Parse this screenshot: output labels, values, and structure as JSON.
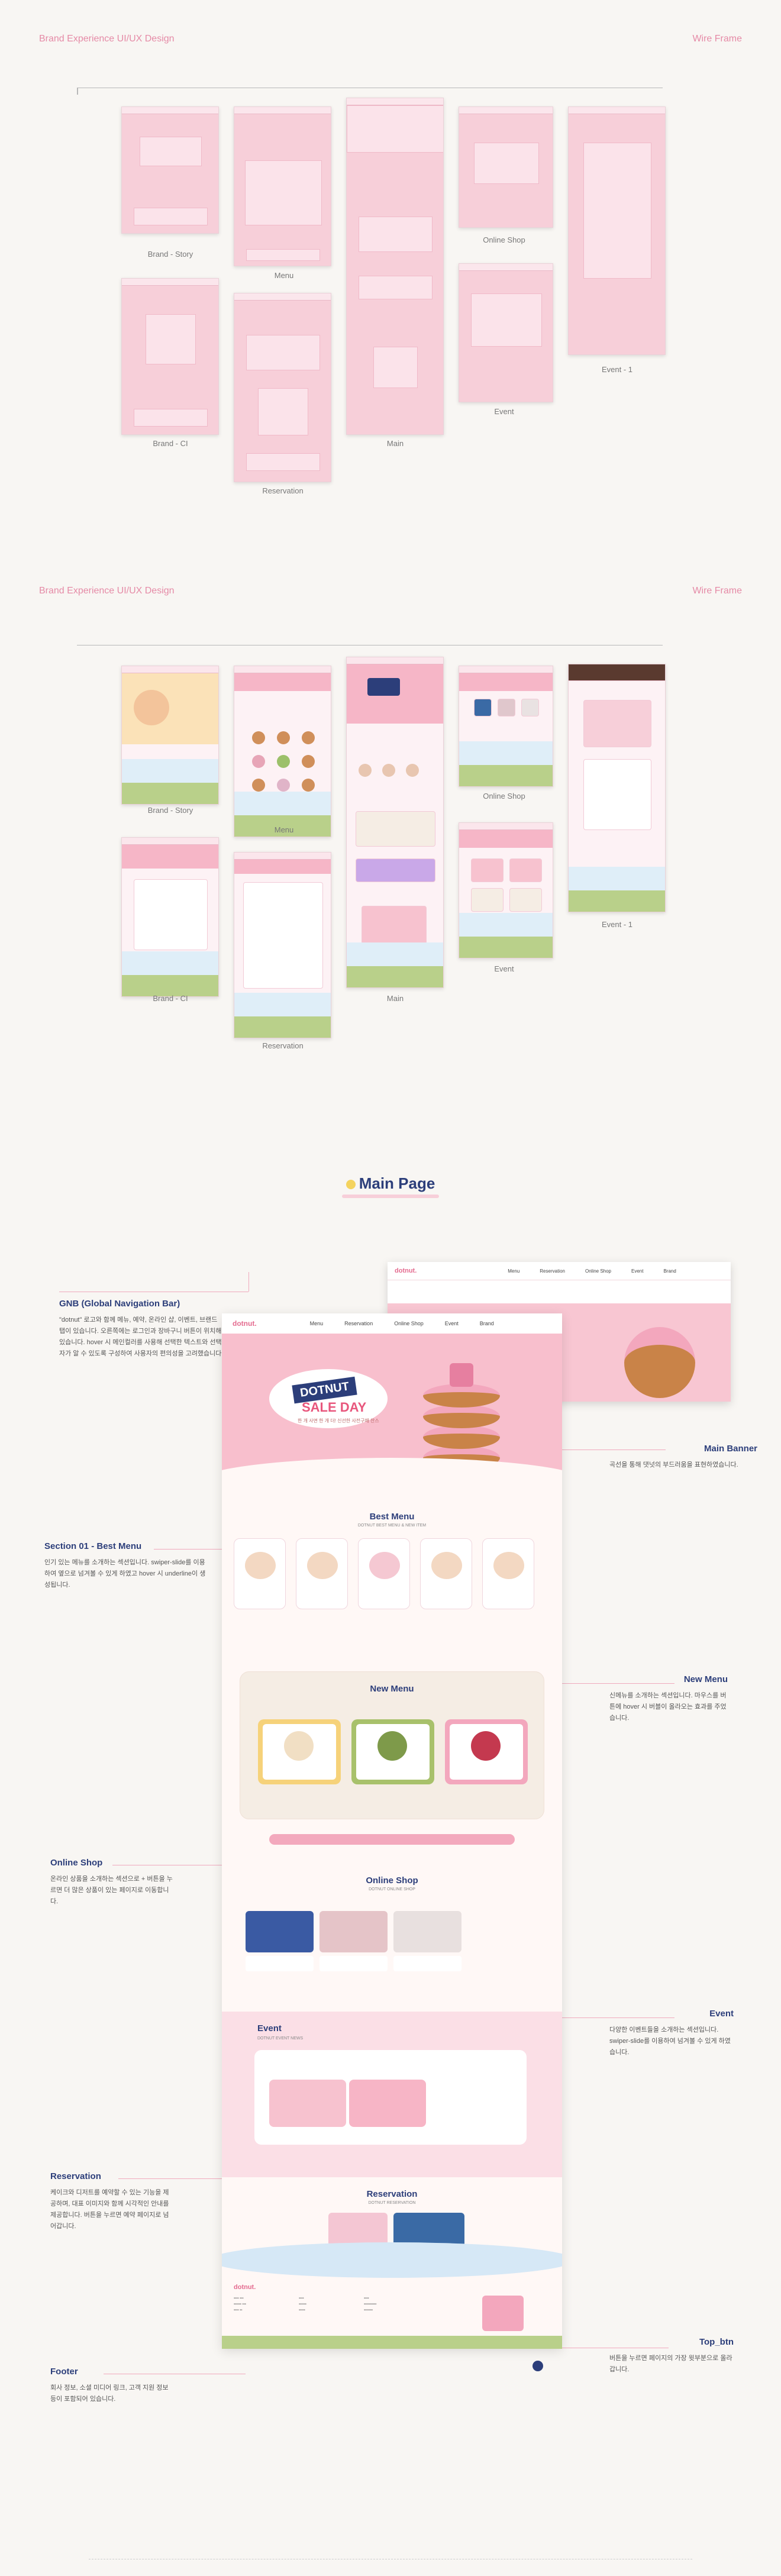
{
  "headers": [
    {
      "left": "Brand Experience UI/UX Design",
      "right": "Wire Frame"
    },
    {
      "left": "Brand Experience UI/UX Design",
      "right": "Wire Frame"
    }
  ],
  "frame_labels": {
    "brand_story": "Brand - Story",
    "brand_ci": "Brand - CI",
    "menu": "Menu",
    "reservation": "Reservation",
    "main": "Main",
    "online_shop": "Online Shop",
    "event": "Event",
    "event_1": "Event - 1"
  },
  "main_page": {
    "title": "Main Page"
  },
  "annotations": {
    "gnb": {
      "title": "GNB (Global Navigation Bar)",
      "body": "\"dotnut\" 로고와 함께 메뉴, 예약, 온라인 샵, 이벤트, 브랜드 탭이 있습니다. 오른쪽에는 로그인과 장바구니 버튼이 위치해 있습니다. hover 시 메인컬러를 사용해 선택한 텍스트와 선택자가 알 수 있도록 구성하여 사용자의 편의성을 고려했습니다."
    },
    "main_banner": {
      "title": "Main Banner",
      "body": "곡선을 통해 댓넛의 부드러움을 표현하였습니다."
    },
    "best_menu": {
      "title": "Section 01 - Best Menu",
      "body": "인기 있는 메뉴를 소개하는 섹션입니다. swiper-slide를 이용하여 옆으로 넘겨볼 수 있게 하였고 hover 시 underline이 생성됩니다."
    },
    "new_menu": {
      "title": "New Menu",
      "body": "신메뉴를 소개하는 섹션입니다. 마우스를 버튼에 hover 시 버블이 올라오는 효과를 주었습니다."
    },
    "online_shop": {
      "title": "Online Shop",
      "body": "온라인 상품을 소개하는 섹션으로 + 버튼을 누르면 더 많은 상품이 있는 페이지로 이동합니다."
    },
    "event": {
      "title": "Event",
      "body": "다양한 이벤트들을 소개하는 섹션입니다. swiper-slide를 이용하여 넘겨볼 수 있게 하였습니다."
    },
    "reservation": {
      "title": "Reservation",
      "body": "케이크와 디저트를 예약할 수 있는 기능을 제공하며, 대표 이미지와 함께 시각적인 안내를 제공합니다. 버튼을 누르면 예약 페이지로 넘어갑니다."
    },
    "top_btn": {
      "title": "Top_btn",
      "body": "버튼을 누르면 페이지의 가장 윗부분으로 올라갑니다."
    },
    "footer": {
      "title": "Footer",
      "body": "회사 정보, 소셜 미디어 링크, 고객 지원 정보 등이 포함되어 있습니다."
    }
  },
  "site": {
    "logo": "dotnut.",
    "nav": [
      "Menu",
      "Reservation",
      "Online Shop",
      "Event",
      "Brand"
    ],
    "banner": {
      "line1": "DOTNUT",
      "line2": "SALE DAY",
      "line3": "한 개 사면 한 개 더! 신선한 사전구매 찬스"
    },
    "best_menu": {
      "title": "Best Menu",
      "sub": "DOTNUT BEST MENU & NEW ITEM"
    },
    "new_menu": {
      "title": "New Menu"
    },
    "online_shop": {
      "title": "Online Shop",
      "sub": "DOTNUT ONLINE SHOP"
    },
    "event": {
      "title": "Event",
      "sub": "DOTNUT EVENT NEWS"
    },
    "reservation": {
      "title": "Reservation",
      "sub": "DOTNUT RESERVATION"
    },
    "footer_logo": "dotnut."
  },
  "colors": {
    "accent": "#e58aa6",
    "navy": "#2c3e7a",
    "pink": "#f7cfd9"
  }
}
